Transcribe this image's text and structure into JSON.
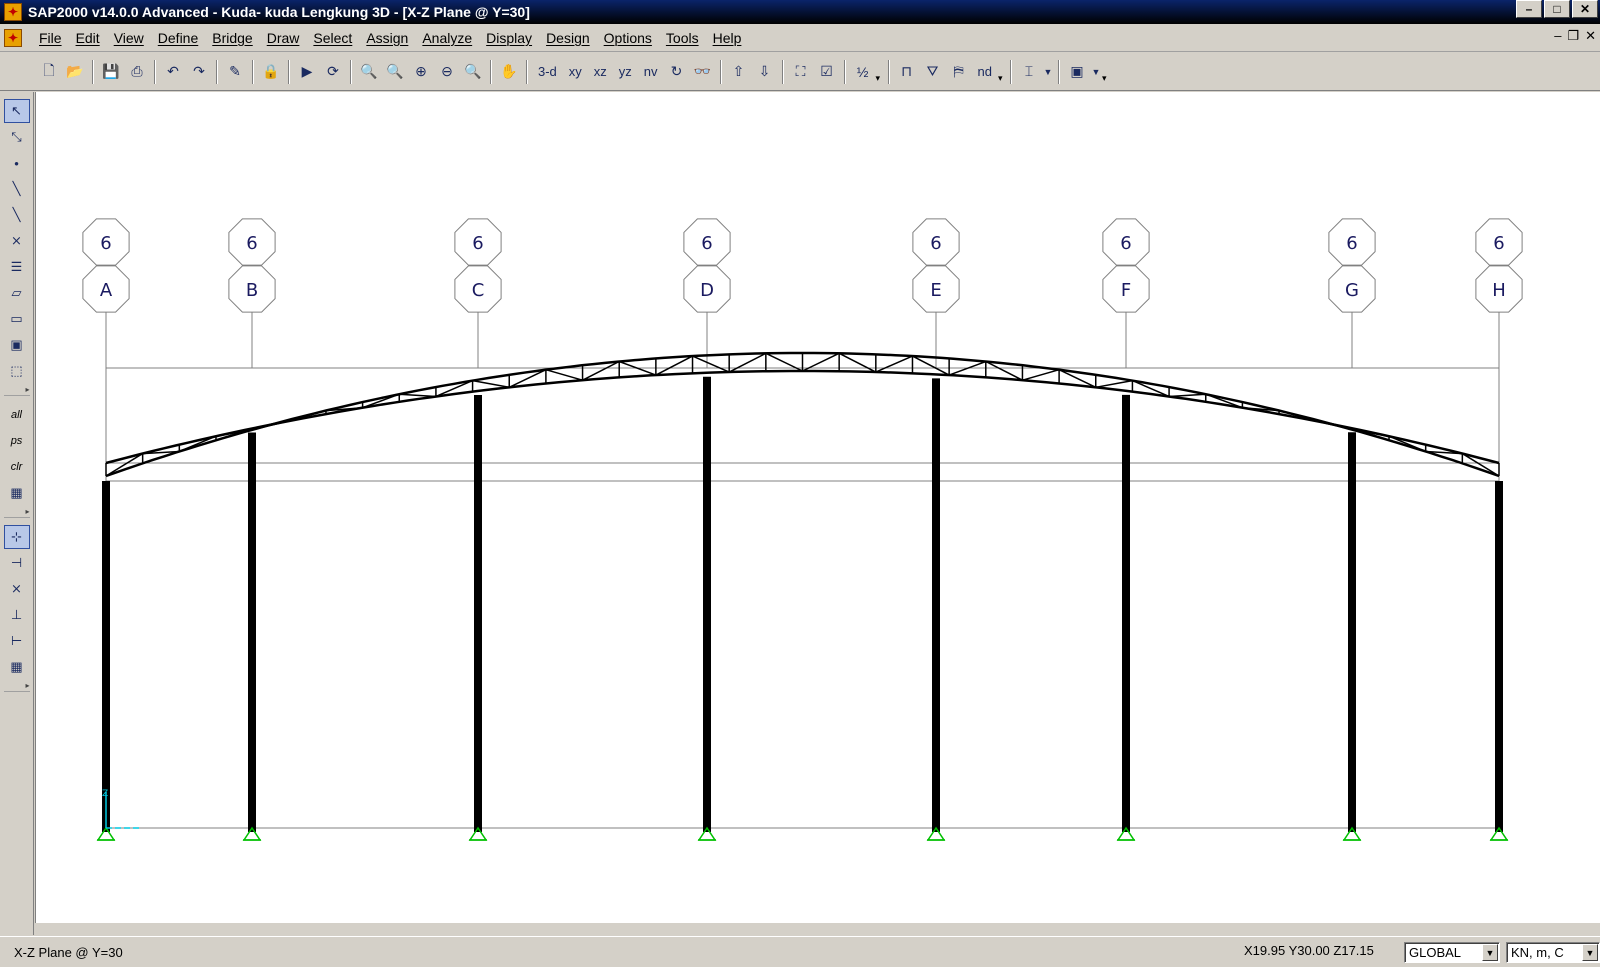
{
  "window": {
    "title": "SAP2000 v14.0.0 Advanced  - Kuda- kuda Lengkung 3D - [X-Z Plane @ Y=30]",
    "controls": [
      "–",
      "□",
      "✕"
    ],
    "mdi_controls": [
      "–",
      "❐",
      "✕"
    ]
  },
  "menu": [
    {
      "name": "file",
      "label": "File"
    },
    {
      "name": "edit",
      "label": "Edit"
    },
    {
      "name": "view",
      "label": "View"
    },
    {
      "name": "define",
      "label": "Define"
    },
    {
      "name": "bridge",
      "label": "Bridge"
    },
    {
      "name": "draw",
      "label": "Draw"
    },
    {
      "name": "select",
      "label": "Select"
    },
    {
      "name": "assign",
      "label": "Assign"
    },
    {
      "name": "analyze",
      "label": "Analyze"
    },
    {
      "name": "display",
      "label": "Display"
    },
    {
      "name": "design",
      "label": "Design"
    },
    {
      "name": "options",
      "label": "Options"
    },
    {
      "name": "tools",
      "label": "Tools"
    },
    {
      "name": "help",
      "label": "Help"
    }
  ],
  "toolbar": {
    "view_3d": "3-d",
    "view_xy": "xy",
    "view_xz": "xz",
    "view_yz": "yz",
    "view_nv": "nv",
    "nd": "nd"
  },
  "left_toolbar": {
    "select_all": "all",
    "previous_selection": "ps",
    "clear_selection": "clr"
  },
  "grid": {
    "z_label": "6",
    "x_labels": [
      "A",
      "B",
      "C",
      "D",
      "E",
      "F",
      "G",
      "H"
    ]
  },
  "axes": {
    "z": "Z"
  },
  "status": {
    "view_name": "X-Z Plane @ Y=30",
    "coordinates": "X19.95  Y30.00  Z17.15",
    "coord_system": "GLOBAL",
    "units": "KN, m, C"
  },
  "colors": {
    "titlebar": "#0a246a",
    "support": "#00c000",
    "local_axis": "#00c8e0",
    "frame": "#000000",
    "grid": "#808080"
  }
}
